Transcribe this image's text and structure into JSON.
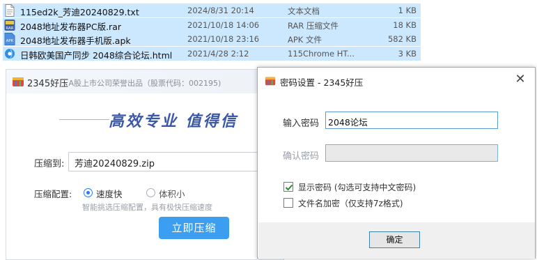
{
  "file_list": {
    "files": [
      {
        "icon": "text-file-icon",
        "name": "115ed2k_芳迪20240829.txt",
        "date": "2024/8/31 20:14",
        "type": "文本文档",
        "size": "1 KB"
      },
      {
        "icon": "rar-archive-icon",
        "name": "2048地址发布器PC版.rar",
        "date": "2021/10/18 14:06",
        "type": "RAR 压缩文件",
        "size": "18 KB"
      },
      {
        "icon": "apk-file-icon",
        "name": "2048地址发布器手机版.apk",
        "date": "2021/10/18 23:16",
        "type": "APK 文件",
        "size": "582 KB"
      },
      {
        "icon": "html-file-icon",
        "name": "日韩欧美国产同步 2048综合论坛.html",
        "date": "2021/4/28 2:12",
        "type": "115Chrome HT...",
        "size": "3 KB"
      }
    ],
    "icon_labels": {
      "rar": "RAR",
      "apk": "APK"
    }
  },
  "compress_window": {
    "title": "2345好压",
    "subtitle": "- A股上市公司荣誉出品（股票代码：002195)",
    "slogan": "高效专业  值得信",
    "compress_to_label": "压缩到:",
    "compress_to_value": "芳迪20240829.zip",
    "config_label": "压缩配置:",
    "options": [
      {
        "label": "速度快",
        "checked": true
      },
      {
        "label": "体积小",
        "checked": false
      }
    ],
    "hint": "智能挑选压缩配置，具有极快压缩速度",
    "compress_button": "立即压缩",
    "accent_color": "#3c9ef0"
  },
  "password_dialog": {
    "title": "密码设置 - 2345好压",
    "close_symbol": "✕",
    "password_label": "输入密码",
    "password_value": "2048论坛",
    "confirm_label": "确认密码",
    "confirm_value": "",
    "show_password_label": "显示密码 (勾选可支持中文密码)",
    "show_password_checked": true,
    "encrypt_filename_label": "文件名加密（仅支持7z格式)",
    "encrypt_filename_checked": false,
    "ok_button": "确定"
  }
}
